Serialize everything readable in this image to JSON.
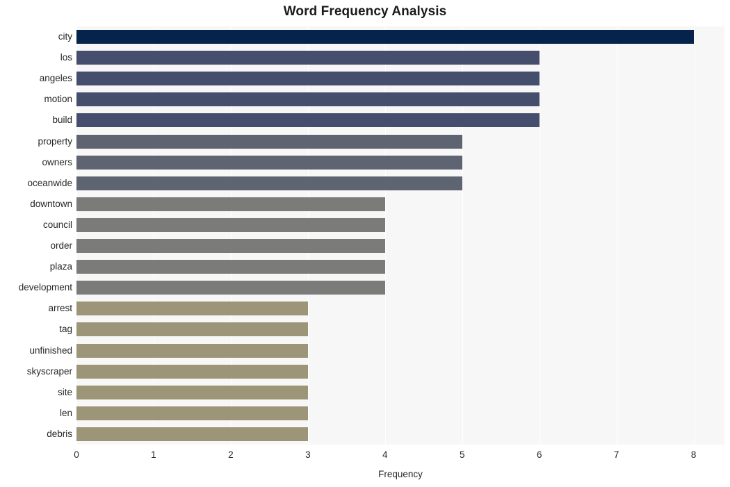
{
  "chart_data": {
    "type": "bar",
    "orientation": "horizontal",
    "title": "Word Frequency Analysis",
    "xlabel": "Frequency",
    "ylabel": "",
    "categories": [
      "city",
      "los",
      "angeles",
      "motion",
      "build",
      "property",
      "owners",
      "oceanwide",
      "downtown",
      "council",
      "order",
      "plaza",
      "development",
      "arrest",
      "tag",
      "unfinished",
      "skyscraper",
      "site",
      "len",
      "debris"
    ],
    "values": [
      8,
      6,
      6,
      6,
      6,
      5,
      5,
      5,
      4,
      4,
      4,
      4,
      4,
      3,
      3,
      3,
      3,
      3,
      3,
      3
    ],
    "bar_colors": [
      "#05234b",
      "#454e6d",
      "#454e6d",
      "#454e6d",
      "#454e6d",
      "#5f6472",
      "#5f6472",
      "#5f6472",
      "#7b7b79",
      "#7b7b79",
      "#7b7b79",
      "#7b7b79",
      "#7b7b79",
      "#9c9578",
      "#9c9578",
      "#9c9578",
      "#9c9578",
      "#9c9578",
      "#9c9578",
      "#9c9578"
    ],
    "xlim": [
      0,
      8.4
    ],
    "x_ticks": [
      0,
      1,
      2,
      3,
      4,
      5,
      6,
      7,
      8
    ],
    "x_tick_labels": [
      "0",
      "1",
      "2",
      "3",
      "4",
      "5",
      "6",
      "7",
      "8"
    ],
    "grid": true,
    "grid_axis": "x",
    "grid_color": "#ffffff",
    "legend": false,
    "plot_background": "#f7f7f7",
    "figure_background": "#ffffff",
    "text_color": "#262626"
  }
}
